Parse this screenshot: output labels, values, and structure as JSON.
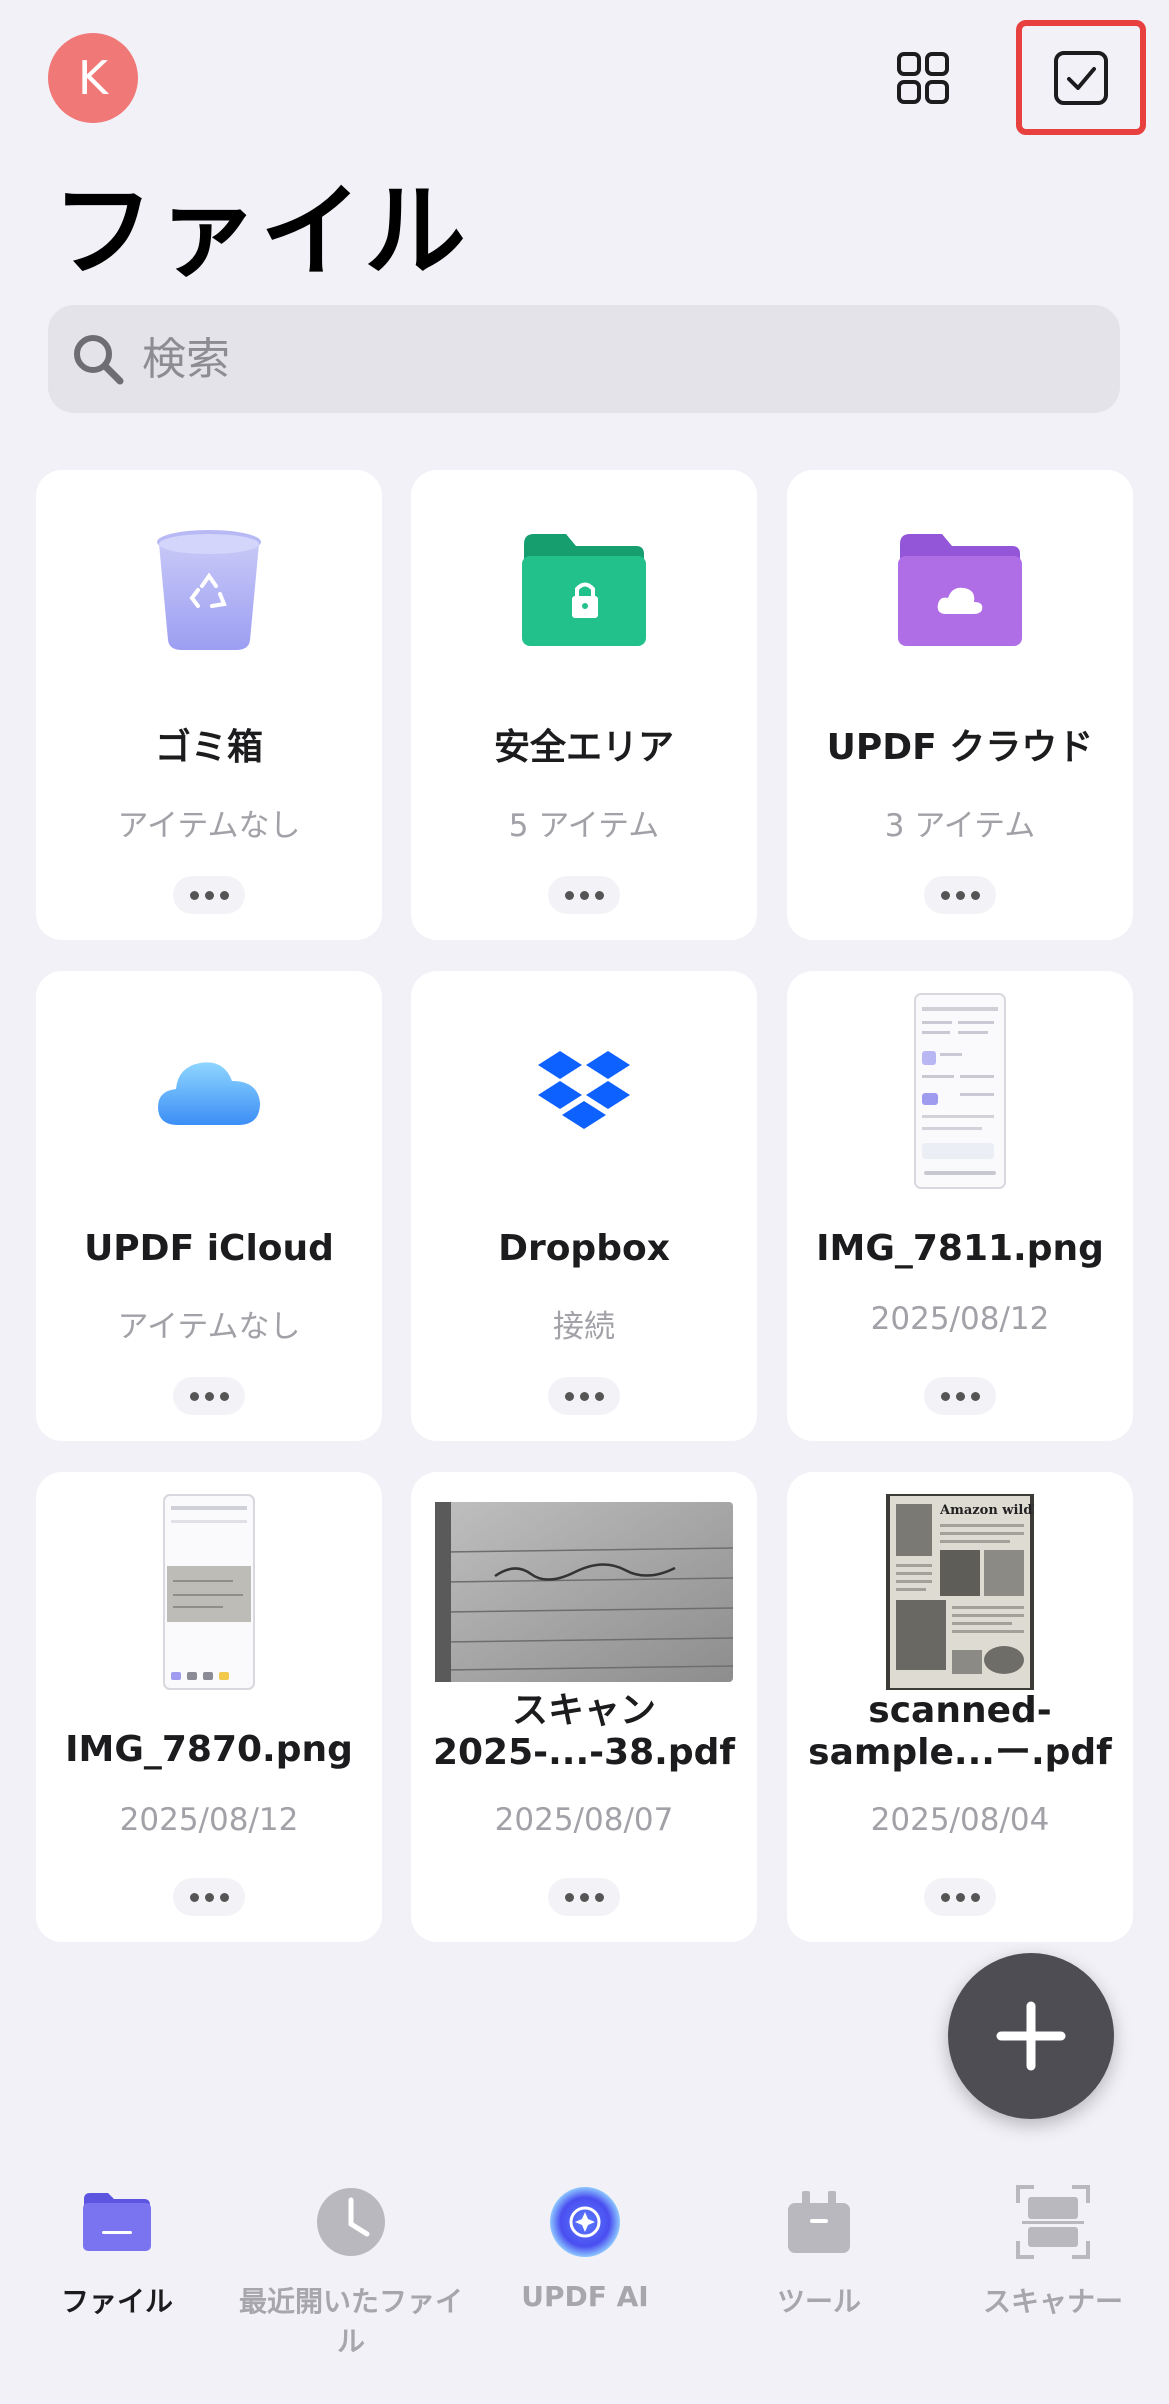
{
  "header": {
    "avatar_letter": "K",
    "title": "ファイル",
    "grid_icon": "grid-icon",
    "select_icon": "checkbox-icon"
  },
  "search": {
    "placeholder": "検索"
  },
  "items": [
    {
      "name": "ゴミ箱",
      "meta": "アイテムなし",
      "icon": "trash-icon"
    },
    {
      "name": "安全エリア",
      "meta": "5 アイテム",
      "icon": "secure-folder-icon"
    },
    {
      "name": "UPDF クラウド",
      "meta": "3 アイテム",
      "icon": "cloud-folder-icon"
    },
    {
      "name": "UPDF iCloud",
      "meta": "アイテムなし",
      "icon": "icloud-icon"
    },
    {
      "name": "Dropbox",
      "meta": "接続",
      "icon": "dropbox-icon"
    },
    {
      "name": "IMG_7811.png",
      "meta": "2025/08/12",
      "icon": "screenshot-thumbnail"
    },
    {
      "name": "IMG_7870.png",
      "meta": "2025/08/12",
      "icon": "screenshot-thumbnail"
    },
    {
      "name_line1": "スキャン",
      "name_line2": "2025-...-38.pdf",
      "meta": "2025/08/07",
      "icon": "scan-thumbnail"
    },
    {
      "name_line1": "scanned-",
      "name_line2": "sample...ー.pdf",
      "meta": "2025/08/04",
      "icon": "document-thumbnail",
      "thumb_title": "Amazon wildlife"
    }
  ],
  "tabs": [
    {
      "label": "ファイル",
      "icon": "files-folder-icon",
      "active": true
    },
    {
      "label": "最近開いたファイル",
      "icon": "clock-icon",
      "active": false
    },
    {
      "label": "UPDF AI",
      "icon": "ai-icon",
      "active": false
    },
    {
      "label": "ツール",
      "icon": "toolbox-icon",
      "active": false
    },
    {
      "label": "スキャナー",
      "icon": "scanner-icon",
      "active": false
    }
  ],
  "colors": {
    "background": "#f2f1f7",
    "avatar": "#f07877",
    "highlight": "#e8403f",
    "secure_folder": "#22c08a",
    "cloud_folder": "#b06ee6",
    "active_tab": "#7b74f0"
  }
}
